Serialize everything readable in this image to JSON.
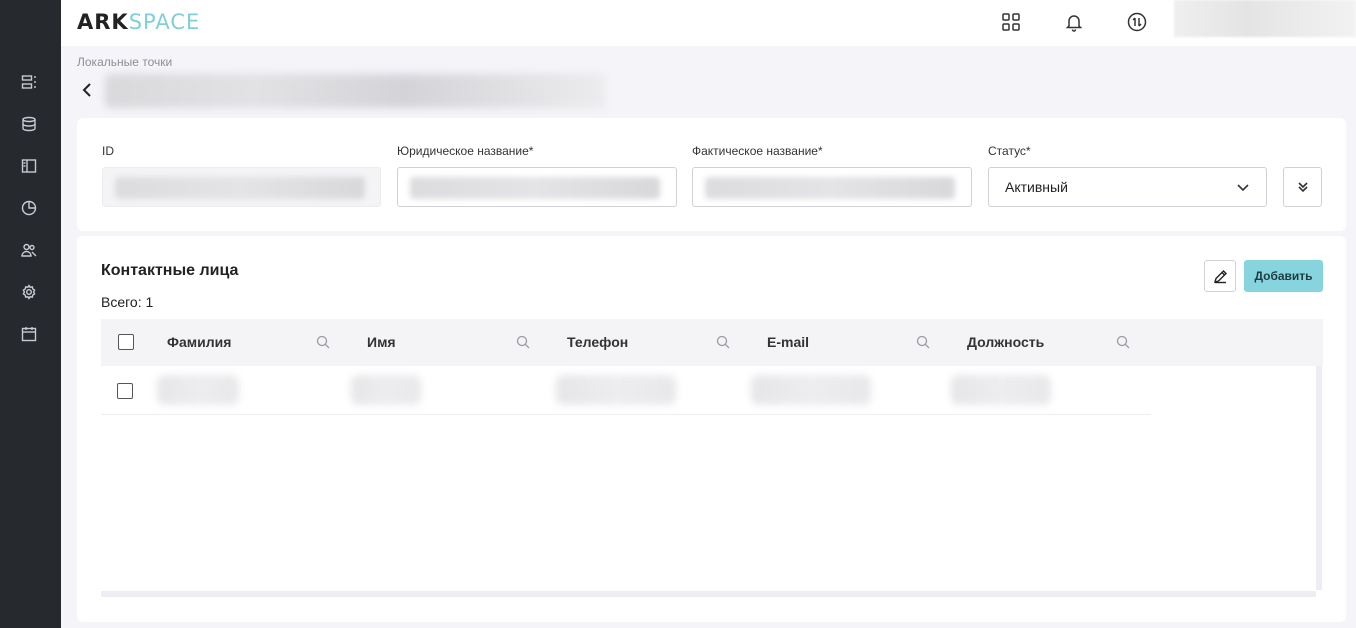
{
  "app": {
    "logo_ark": "ARK",
    "logo_space": "SPACE"
  },
  "sidebar": {
    "items": [
      {
        "icon": "list-icon"
      },
      {
        "icon": "database-icon"
      },
      {
        "icon": "panel-icon"
      },
      {
        "icon": "chart-pie-icon"
      },
      {
        "icon": "users-icon"
      },
      {
        "icon": "gear-icon"
      },
      {
        "icon": "calendar-icon"
      }
    ]
  },
  "header": {
    "icons": [
      "apps-grid-icon",
      "bell-icon",
      "exchange-icon"
    ]
  },
  "breadcrumb": "Локальные точки",
  "form": {
    "id_label": "ID",
    "legal_name_label": "Юридическое название*",
    "actual_name_label": "Фактическое название*",
    "status_label": "Статус*",
    "status_value": "Активный"
  },
  "contacts": {
    "title": "Контактные лица",
    "total": "Всего: 1",
    "add_label": "Добавить",
    "columns": [
      "Фамилия",
      "Имя",
      "Телефон",
      "E-mail",
      "Должность"
    ]
  },
  "colors": {
    "sidebar_bg": "#26292e",
    "accent": "#86d4dd",
    "logo_accent": "#7fcfd8",
    "page_bg": "#f4f4f9"
  }
}
